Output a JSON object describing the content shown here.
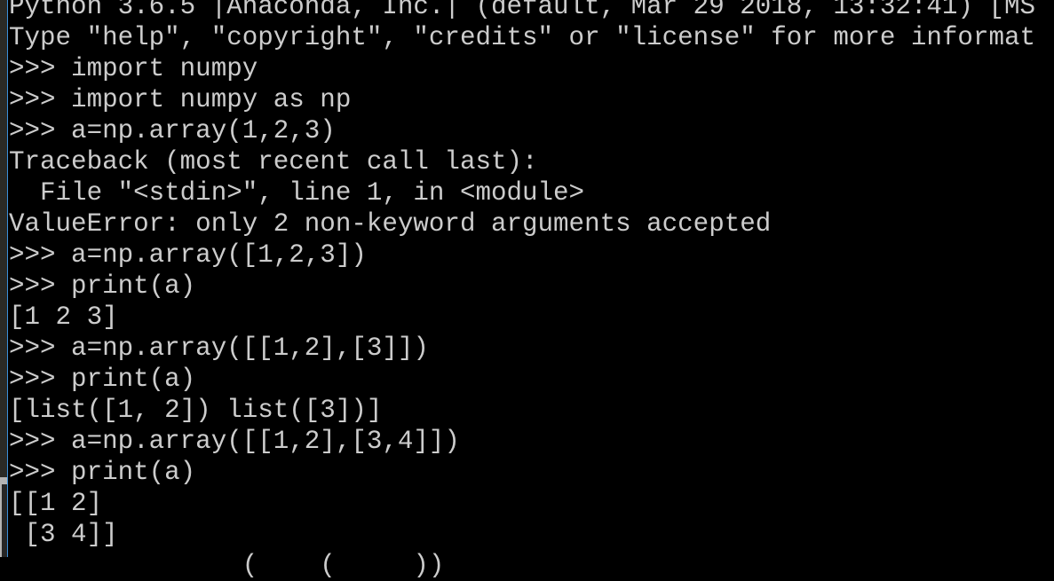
{
  "window": {
    "type": "python-interactive-console",
    "colors": {
      "background": "#000000",
      "text": "#cccccc",
      "focus_border": "#3b8fd9"
    }
  },
  "console": {
    "lines": [
      "Python 3.6.5 |Anaconda, Inc.| (default, Mar 29 2018, 13:32:41) [MS",
      "Type \"help\", \"copyright\", \"credits\" or \"license\" for more informat",
      ">>> import numpy",
      ">>> import numpy as np",
      ">>> a=np.array(1,2,3)",
      "Traceback (most recent call last):",
      "  File \"<stdin>\", line 1, in <module>",
      "ValueError: only 2 non-keyword arguments accepted",
      ">>> a=np.array([1,2,3])",
      ">>> print(a)",
      "[1 2 3]",
      ">>> a=np.array([[1,2],[3]])",
      ">>> print(a)",
      "[list([1, 2]) list([3])]",
      ">>> a=np.array([[1,2],[3,4]])",
      ">>> print(a)",
      "[[1 2]",
      " [3 4]]",
      "               (    (     ))"
    ]
  }
}
